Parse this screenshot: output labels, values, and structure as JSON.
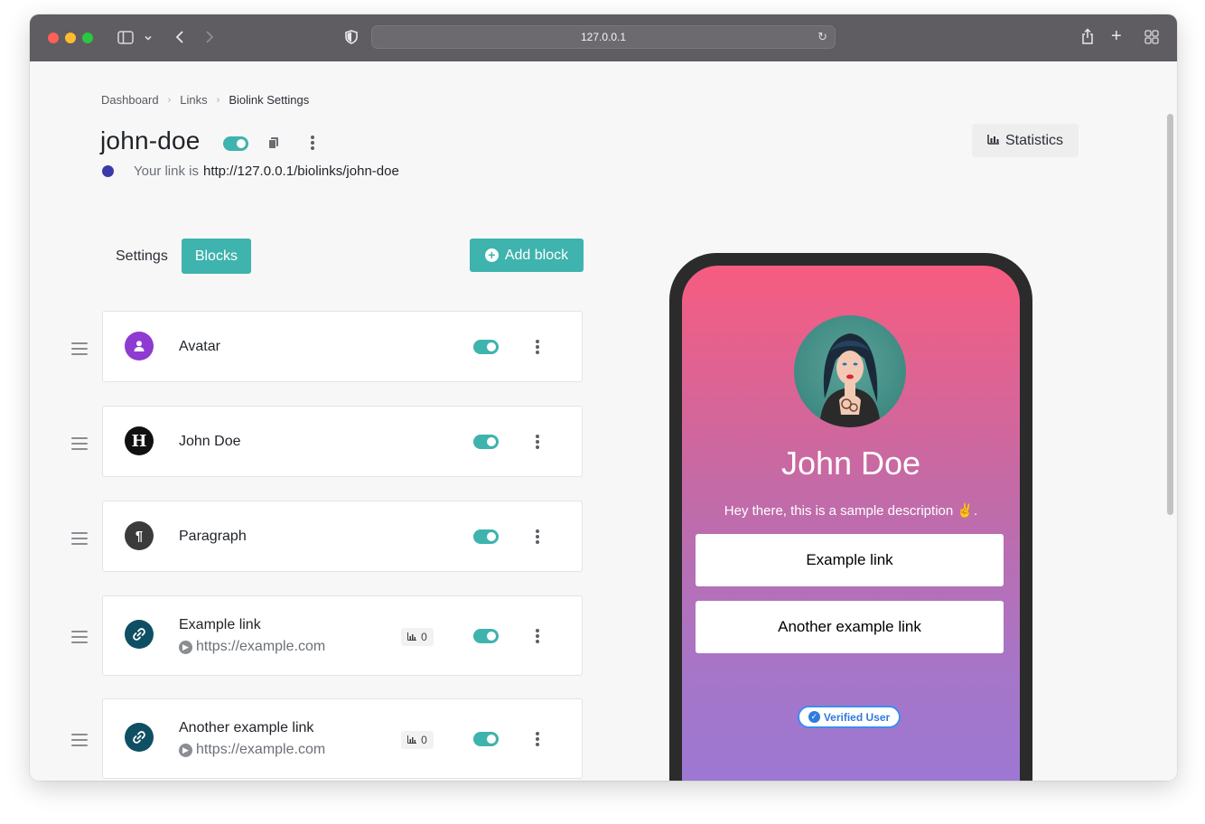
{
  "browser": {
    "url": "127.0.0.1",
    "icons": [
      "sidebar-icon",
      "chevron-down-icon",
      "back-icon",
      "forward-icon",
      "shield-icon",
      "reload-icon",
      "share-icon",
      "new-tab-icon",
      "tab-overview-icon"
    ]
  },
  "breadcrumb": {
    "items": [
      "Dashboard",
      "Links",
      "Biolink Settings"
    ]
  },
  "header": {
    "title": "john-doe",
    "link_prefix": "Your link is",
    "link_url": "http://127.0.0.1/biolinks/john-doe",
    "statistics_label": "Statistics"
  },
  "tabs": [
    {
      "label": "Settings",
      "active": false
    },
    {
      "label": "Blocks",
      "active": true
    }
  ],
  "add_block_label": "Add block",
  "blocks": [
    {
      "title": "Avatar",
      "icon": "user-icon",
      "color": "#8f3ad1"
    },
    {
      "title": "John Doe",
      "icon": "heading-icon",
      "color": "#111111"
    },
    {
      "title": "Paragraph",
      "icon": "paragraph-icon",
      "color": "#3b3b3b"
    },
    {
      "title": "Example link",
      "subtitle": "https://example.com",
      "clicks": "0",
      "icon": "link-icon",
      "color": "#0f4f63"
    },
    {
      "title": "Another example link",
      "subtitle": "https://example.com",
      "clicks": "0",
      "icon": "link-icon",
      "color": "#0f4f63"
    }
  ],
  "preview": {
    "name": "John Doe",
    "description": "Hey there, this is a sample description ✌️.",
    "links": [
      "Example link",
      "Another example link"
    ],
    "verified_label": "Verified User"
  },
  "colors": {
    "accent": "#3fb3ad",
    "gradient_top": "#f75c80",
    "gradient_bottom": "#9a78d6",
    "verified_blue": "#2f7be0"
  }
}
